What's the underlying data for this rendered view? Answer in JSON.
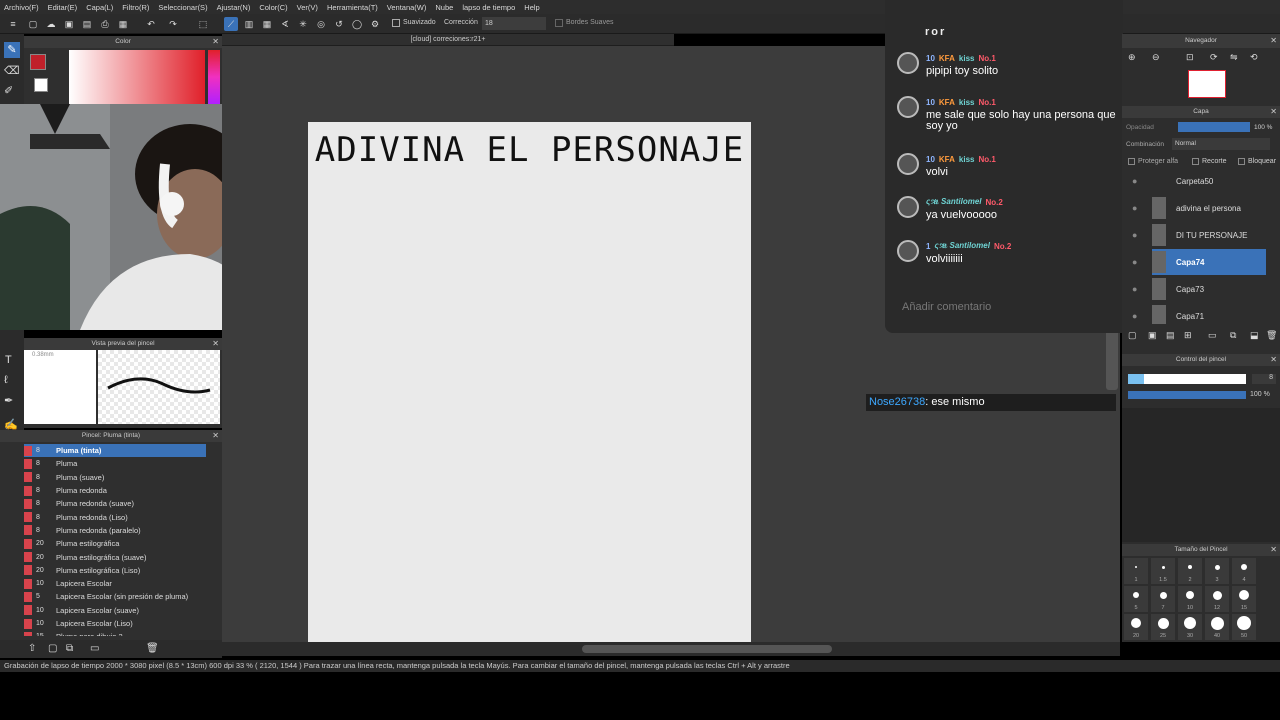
{
  "menu": [
    "Archivo(F)",
    "Editar(E)",
    "Capa(L)",
    "Filtro(R)",
    "Seleccionar(S)",
    "Ajustar(N)",
    "Color(C)",
    "Ver(V)",
    "Herramienta(T)",
    "Ventana(W)",
    "Nube",
    "lapso de tiempo",
    "Help"
  ],
  "toolbar": {
    "smoothing_label": "Suavizado",
    "correction_label": "Corrección",
    "correction_value": "18",
    "soft_edges_label": "Bordes Suaves"
  },
  "document_tab": "[cloud] correciones:r21+",
  "color_panel": {
    "title": "Color"
  },
  "brush_preview": {
    "title": "Vista previa del pincel",
    "size": "0.38mm"
  },
  "brush_panel": {
    "title": "Pincel: Pluma (tinta)",
    "items": [
      {
        "size": "8",
        "name": "Pluma (tinta)",
        "selected": true
      },
      {
        "size": "8",
        "name": "Pluma"
      },
      {
        "size": "8",
        "name": "Pluma (suave)"
      },
      {
        "size": "8",
        "name": "Pluma redonda"
      },
      {
        "size": "8",
        "name": "Pluma redonda (suave)"
      },
      {
        "size": "8",
        "name": "Pluma redonda (Liso)"
      },
      {
        "size": "8",
        "name": "Pluma redonda (paralelo)"
      },
      {
        "size": "20",
        "name": "Pluma estilográfica"
      },
      {
        "size": "20",
        "name": "Pluma estilográfica (suave)"
      },
      {
        "size": "20",
        "name": "Pluma estilográfica (Liso)"
      },
      {
        "size": "10",
        "name": "Lapicera Escolar"
      },
      {
        "size": "5",
        "name": "Lapicera Escolar (sin presión de pluma)"
      },
      {
        "size": "10",
        "name": "Lapicera Escolar (suave)"
      },
      {
        "size": "10",
        "name": "Lapicera Escolar (Liso)"
      },
      {
        "size": "15",
        "name": "Pluma para dibujo 2"
      }
    ]
  },
  "canvas": {
    "title_text": "ADIVINA EL PERSONAJE"
  },
  "chat": {
    "header": "ror",
    "messages": [
      {
        "level": "10",
        "badge": "KFA",
        "kiss": "kiss",
        "no": "No.1",
        "text": "pipipi toy solito"
      },
      {
        "level": "10",
        "badge": "KFA",
        "kiss": "kiss",
        "no": "No.1",
        "text": "me sale que solo hay una persona que soy yo"
      },
      {
        "level": "10",
        "badge": "KFA",
        "kiss": "kiss",
        "no": "No.1",
        "text": "volvi"
      },
      {
        "name": "ςૠ Santilomel",
        "no": "No.2",
        "text": "ya vuelvooooo"
      },
      {
        "level": "1",
        "name": "ςૠ Santilomel",
        "no": "No.2",
        "text": "volviiiiiii"
      }
    ],
    "placeholder": "Añadir comentario"
  },
  "notice": {
    "user": "Nose26738",
    "text": ": ese mismo"
  },
  "navigator": {
    "title": "Navegador"
  },
  "layer_panel": {
    "title": "Capa",
    "opacity_label": "Opacidad",
    "opacity_value": "100 %",
    "blend_label": "Combinación",
    "blend_value": "Normal",
    "protect_alpha": "Proteger alfa",
    "clip": "Recorte",
    "lock": "Bloquear",
    "layers": [
      "Carpeta50",
      "adivina el persona",
      "DI TU PERSONAJE",
      "Capa74",
      "Capa73",
      "Capa71"
    ]
  },
  "brush_control": {
    "title": "Control del pincel",
    "size_value": "8",
    "opacity_value": "100 %"
  },
  "brush_size": {
    "title": "Tamaño del Pincel",
    "sizes": [
      "1",
      "1.5",
      "2",
      "3",
      "4",
      "5",
      "7",
      "10",
      "12",
      "15",
      "20",
      "25",
      "30",
      "40",
      "50"
    ]
  },
  "statusbar": {
    "text": "Grabación de lapso de tiempo   2000 * 3080 pixel  (8.5 * 13cm)  600 dpi   33 %   ( 2120, 1544 )   Para trazar una línea recta, mantenga pulsada la tecla Mayús. Para cambiar el tamaño del pincel, mantenga pulsada las teclas Ctrl + Alt y arrastre"
  },
  "colors": {
    "accent": "#3a72b8",
    "brush_swatch": "#d8434c",
    "fg_color": "#c0202a"
  }
}
